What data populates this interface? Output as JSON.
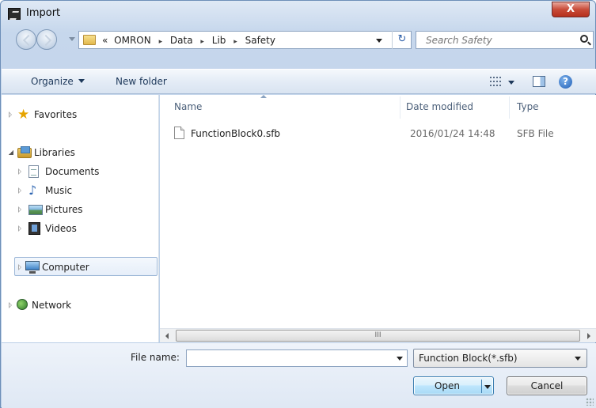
{
  "window": {
    "title": "Import",
    "close_glyph": "X"
  },
  "address": {
    "overflow_marker": "«",
    "crumbs": [
      "OMRON",
      "Data",
      "Lib",
      "Safety"
    ],
    "separator": "▸",
    "refresh_glyph": "↻"
  },
  "search": {
    "placeholder": "Search Safety"
  },
  "toolbar": {
    "organize_label": "Organize",
    "new_folder_label": "New folder",
    "help_glyph": "?"
  },
  "navigation": {
    "favorites": "Favorites",
    "libraries": "Libraries",
    "library_items": [
      "Documents",
      "Music",
      "Pictures",
      "Videos"
    ],
    "computer": "Computer",
    "network": "Network",
    "selected": "Computer"
  },
  "file_list": {
    "columns": {
      "name": "Name",
      "date_modified": "Date modified",
      "type": "Type"
    },
    "rows": [
      {
        "name": "FunctionBlock0.sfb",
        "date_modified": "2016/01/24 14:48",
        "type": "SFB File"
      }
    ],
    "scroll_thumb_glyph": "III"
  },
  "bottom": {
    "file_name_label": "File name:",
    "file_name_value": "",
    "filter_value": "Function Block(*.sfb)",
    "open_label": "Open",
    "cancel_label": "Cancel"
  }
}
